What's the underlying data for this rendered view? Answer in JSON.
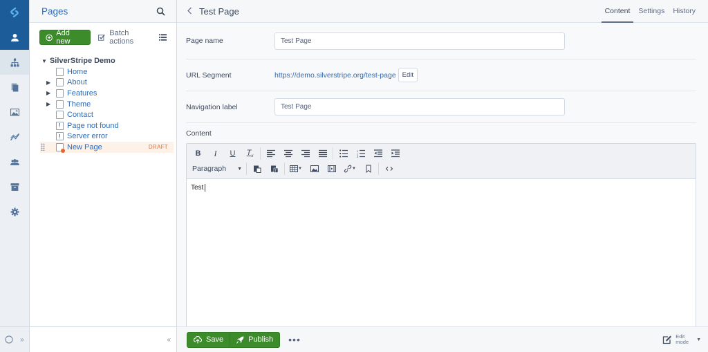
{
  "rail": {
    "items": [
      {
        "icon": "user-icon",
        "state": "active"
      },
      {
        "icon": "sitemap-icon",
        "state": "current"
      },
      {
        "icon": "files-icon",
        "state": ""
      },
      {
        "icon": "image-icon",
        "state": ""
      },
      {
        "icon": "chart-line-icon",
        "state": ""
      },
      {
        "icon": "users-icon",
        "state": ""
      },
      {
        "icon": "archive-icon",
        "state": ""
      },
      {
        "icon": "gear-icon",
        "state": ""
      }
    ],
    "expand_glyph": "»"
  },
  "tree": {
    "title": "Pages",
    "add_new_label": "Add new",
    "batch_actions_label": "Batch actions",
    "root_label": "SilverStripe Demo",
    "collapse_glyph": "«",
    "pages": [
      {
        "label": "Home",
        "has_children": false,
        "type": "page"
      },
      {
        "label": "About",
        "has_children": true,
        "type": "page"
      },
      {
        "label": "Features",
        "has_children": true,
        "type": "page"
      },
      {
        "label": "Theme",
        "has_children": true,
        "type": "page"
      },
      {
        "label": "Contact",
        "has_children": false,
        "type": "page"
      },
      {
        "label": "Page not found",
        "has_children": false,
        "type": "error"
      },
      {
        "label": "Server error",
        "has_children": false,
        "type": "error"
      },
      {
        "label": "New Page",
        "has_children": false,
        "type": "draft",
        "badge": "DRAFT"
      }
    ]
  },
  "main": {
    "title": "Test Page",
    "tabs": [
      {
        "label": "Content",
        "active": true
      },
      {
        "label": "Settings",
        "active": false
      },
      {
        "label": "History",
        "active": false
      }
    ],
    "fields": {
      "page_name_label": "Page name",
      "page_name_value": "Test Page",
      "url_segment_label": "URL Segment",
      "url_segment_value": "https://demo.silverstripe.org/test-page",
      "url_edit_label": "Edit",
      "nav_label_label": "Navigation label",
      "nav_label_value": "Test Page",
      "content_label": "Content"
    },
    "editor": {
      "format_select": "Paragraph",
      "body_text": "Test"
    },
    "footer": {
      "save_label": "Save",
      "publish_label": "Publish",
      "more_label": "•••",
      "edit_mode_line1": "Edit",
      "edit_mode_line2": "mode"
    }
  }
}
